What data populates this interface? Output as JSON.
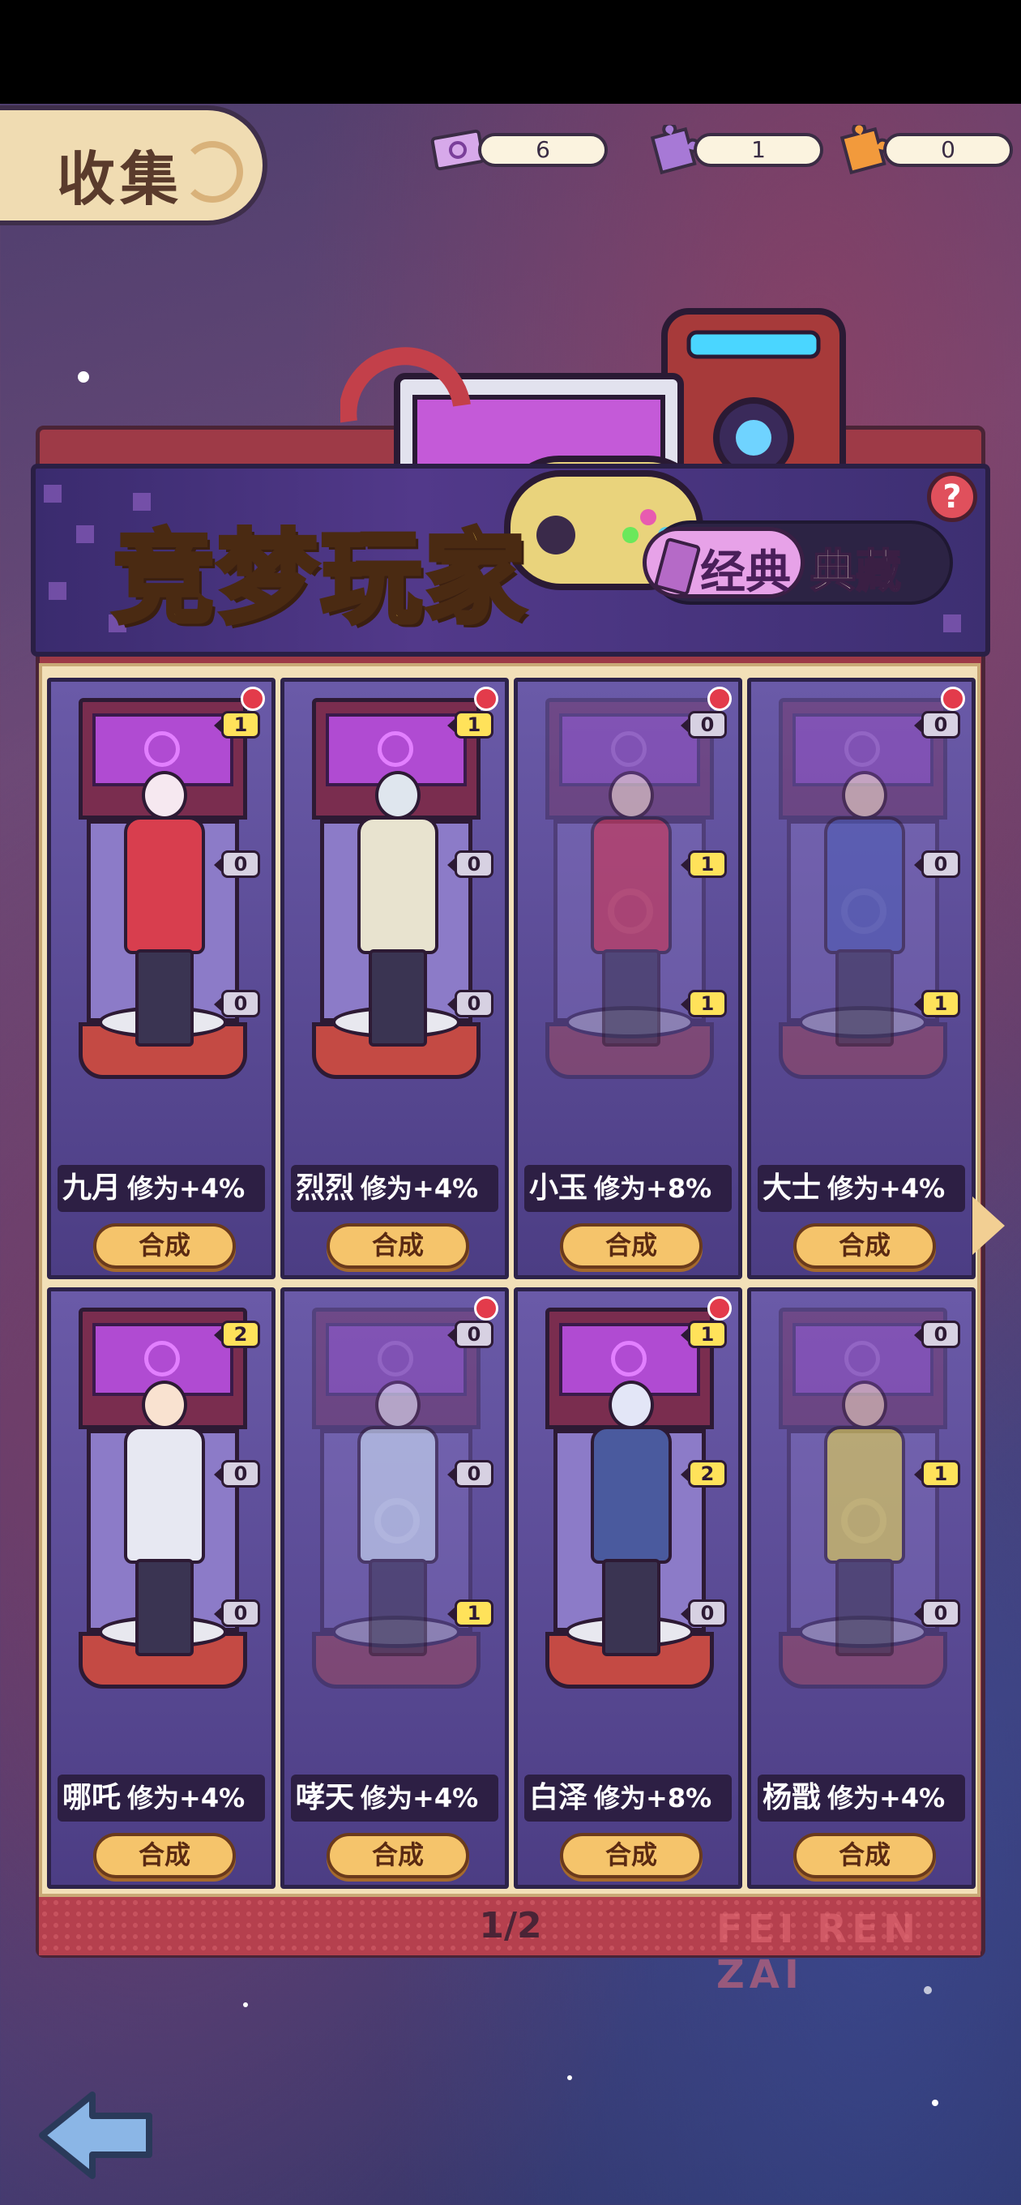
{
  "header": {
    "title": "收集"
  },
  "counters": [
    {
      "icon": "ticket-icon",
      "value": "6"
    },
    {
      "icon": "purple-puzzle-icon",
      "value": "1"
    },
    {
      "icon": "orange-puzzle-icon",
      "value": "0"
    }
  ],
  "banner": {
    "title": "竞梦玩家",
    "tabs": {
      "classic": "经典",
      "collection": "典藏"
    },
    "help": "?"
  },
  "cards": [
    {
      "name": "九月",
      "bonus": "修为+4%",
      "action": "合成",
      "counts": [
        "1",
        "0",
        "0"
      ]
    },
    {
      "name": "烈烈",
      "bonus": "修为+4%",
      "action": "合成",
      "counts": [
        "1",
        "0",
        "0"
      ]
    },
    {
      "name": "小玉",
      "bonus": "修为+8%",
      "action": "合成",
      "counts": [
        "0",
        "1",
        "1"
      ]
    },
    {
      "name": "大士",
      "bonus": "修为+4%",
      "action": "合成",
      "counts": [
        "0",
        "0",
        "1"
      ]
    },
    {
      "name": "哪吒",
      "bonus": "修为+4%",
      "action": "合成",
      "counts": [
        "2",
        "0",
        "0"
      ]
    },
    {
      "name": "哮天",
      "bonus": "修为+4%",
      "action": "合成",
      "counts": [
        "0",
        "0",
        "1"
      ]
    },
    {
      "name": "白泽",
      "bonus": "修为+8%",
      "action": "合成",
      "counts": [
        "1",
        "2",
        "0"
      ]
    },
    {
      "name": "杨戬",
      "bonus": "修为+4%",
      "action": "合成",
      "counts": [
        "0",
        "1",
        "0"
      ]
    }
  ],
  "pager": {
    "text": "1/2"
  },
  "watermark": "FEI REN ZAI",
  "colors": {
    "accent_gold": "#ffd95a",
    "badge_on": "#ffe25a",
    "notify_red": "#e33b4b",
    "frame_red": "#9e3a47"
  }
}
